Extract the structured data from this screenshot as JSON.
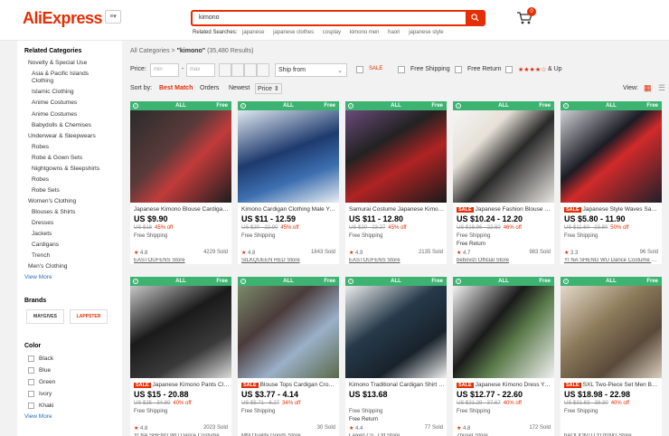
{
  "header": {
    "logo": "AliExpress",
    "menu_label": "≡▾",
    "search_value": "kimono",
    "related_label": "Related Searches:",
    "related": [
      "japanese",
      "japanese clothes",
      "cosplay",
      "kimono men",
      "haori",
      "japanese style"
    ],
    "cart_count": "0"
  },
  "sidebar": {
    "categories_title": "Related Categories",
    "categories": [
      "Novelty & Special Use",
      "Asia & Pacific Islands",
      "Clothing",
      "Islamic Clothing",
      "Anime Costumes",
      "Anime Costumes",
      "Babydolls & Chemises",
      "Underwear & Sleepwears",
      "Robes",
      "Robe & Gown Sets",
      "Nightgowns & Sleepshirts",
      "Robes",
      "Robe Sets",
      "Women's Clothing",
      "Blouses & Shirts",
      "Dresses",
      "Jackets",
      "Cardigans",
      "Trench",
      "Men's Clothing"
    ],
    "view_more": "View More",
    "brands_title": "Brands",
    "brands": [
      "MAYGIVES",
      "LAPPSTER"
    ],
    "color_title": "Color",
    "colors": [
      "Black",
      "Blue",
      "Green",
      "Ivory",
      "Khaki"
    ],
    "color_view_more": "View More"
  },
  "main": {
    "crumb_root": "All Categories",
    "crumb_sep": ">",
    "crumb_query": "\"kimono\"",
    "crumb_count": "(35,480 Results)",
    "price_label": "Price:",
    "min_placeholder": "min",
    "max_placeholder": "max",
    "dash": "-",
    "ship_from": "Ship from",
    "sale_label": "SALE",
    "free_shipping": "Free Shipping",
    "free_return": "Free Return",
    "stars_label": "★★★★☆",
    "and_up": "& Up",
    "sort_label": "Sort by:",
    "sort_options": [
      "Best Match",
      "Orders",
      "Newest",
      "Price ⇕"
    ],
    "view_label": "View:"
  },
  "products": [
    {
      "title": "Japanese Kimono Blouse Cardigan Women",
      "sale": "",
      "price": "US $9.90",
      "orig": "US $18",
      "off": "45% off",
      "ship": "Free Shipping",
      "ret": "",
      "rating": "4.8",
      "sold": "4229 Sold",
      "store": "EASTOUFENS Store"
    },
    {
      "title": "Kimono Cardigan Clothing Male Yukata",
      "sale": "",
      "price": "US $11 - 12.59",
      "orig": "US $20 - 22.90",
      "off": "45% off",
      "ship": "Free Shipping",
      "ret": "",
      "rating": "4.8",
      "sold": "1843 Sold",
      "store": "SILKQUEEN RED Store"
    },
    {
      "title": "Samurai Costume Japanese Kimono Men",
      "sale": "",
      "price": "US $11 - 12.80",
      "orig": "US $20 - 23.27",
      "off": "45% off",
      "ship": "Free Shipping",
      "ret": "",
      "rating": "4.9",
      "sold": "2135 Sold",
      "store": "EASTOUFENS Store"
    },
    {
      "title": "Japanese Fashion Blouse Kimono",
      "sale": "SALE",
      "price": "US $10.24 - 12.20",
      "orig": "US $18.96 - 22.60",
      "off": "46% off",
      "ship": "Free Shipping",
      "ret": "Free Return",
      "rating": "4.7",
      "sold": "983 Sold",
      "store": "bebovizi Official Store"
    },
    {
      "title": "Japanese Style Waves Samurai Kimono",
      "sale": "SALE",
      "price": "US $5.80 - 11.90",
      "orig": "US $11.60 - 23.80",
      "off": "50% off",
      "ship": "Free Shipping",
      "ret": "",
      "rating": "3.3",
      "sold": "96 Sold",
      "store": "YI NA SHENG WU Dance Costume Store"
    },
    {
      "title": "Japanese Kimono Pants Cloak",
      "sale": "SALE",
      "price": "US $15 - 20.88",
      "orig": "US $25 - 34.80",
      "off": "40% off",
      "ship": "Free Shipping",
      "ret": "",
      "rating": "4.8",
      "sold": "2023 Sold",
      "store": "YI NA SHENG WU Dance Costume Store"
    },
    {
      "title": "Blouse Tops Cardigan Cropped Kimono",
      "sale": "SALE",
      "price": "US $3.77 - 4.14",
      "orig": "US $5.71 - 6.27",
      "off": "34% off",
      "ship": "Free Shipping",
      "ret": "",
      "rating": "",
      "sold": "30 Sold",
      "store": "MM Quality Goods Store"
    },
    {
      "title": "Kimono Traditional Cardigan Shirt Men",
      "sale": "",
      "price": "US $13.68",
      "orig": "",
      "off": "",
      "ship": "Free Shipping",
      "ret": "Free Return",
      "rating": "4.4",
      "sold": "77 Sold",
      "store": "Laixen Co., Ltd Store"
    },
    {
      "title": "Japanese Kimono Dress Yukata Women",
      "sale": "SALE",
      "price": "US $12.77 - 22.60",
      "orig": "US $21.29 - 37.67",
      "off": "40% off",
      "ship": "Free Shipping",
      "ret": "",
      "rating": "4.8",
      "sold": "172 Sold",
      "store": "Znuser Store"
    },
    {
      "title": "SXL Two-Piece Set Men Bathrobe Kimono",
      "sale": "SALE",
      "price": "US $18.98 - 22.98",
      "orig": "US $31.63 - 38.30",
      "off": "40% off",
      "ship": "Free Shipping",
      "ret": "",
      "rating": "",
      "sold": "",
      "store": "bAOLIONTU YUYING Store"
    }
  ],
  "badge": {
    "all": "ALL",
    "free": "Free"
  }
}
